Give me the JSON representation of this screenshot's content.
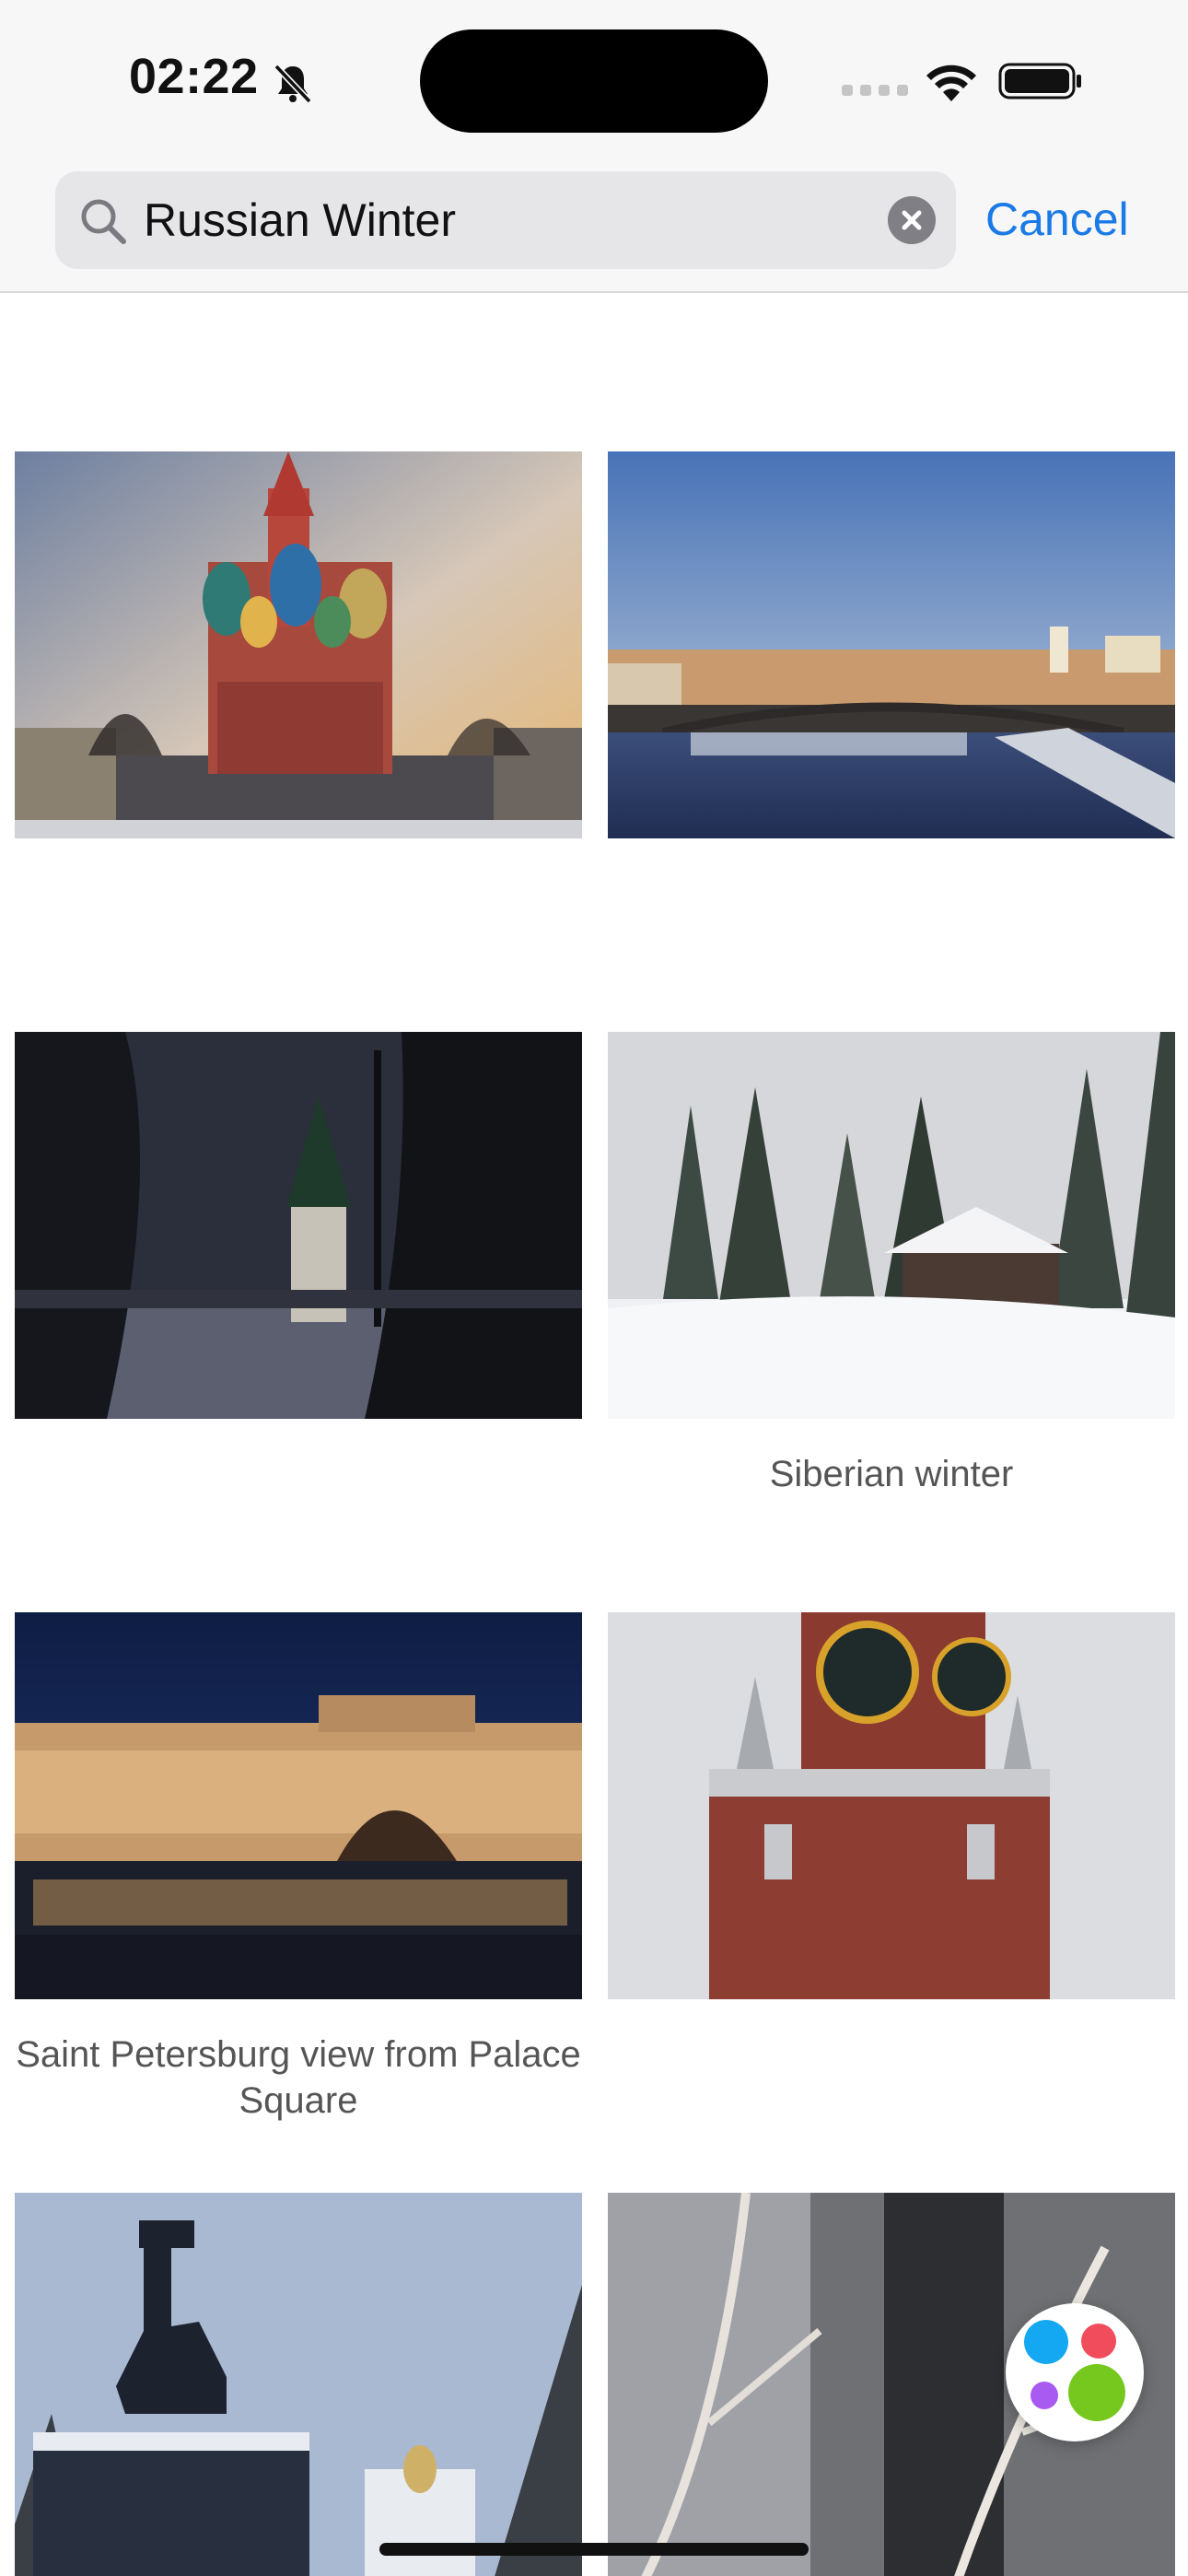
{
  "status": {
    "time": "02:22"
  },
  "search": {
    "query": "Russian Winter",
    "cancel_label": "Cancel"
  },
  "results": [
    {
      "caption": ""
    },
    {
      "caption": ""
    },
    {
      "caption": ""
    },
    {
      "caption": "Siberian winter"
    },
    {
      "caption": "Saint Petersburg view from Palace Square"
    },
    {
      "caption": ""
    },
    {
      "caption": ""
    },
    {
      "caption": ""
    }
  ],
  "colors": {
    "accent": "#1a7ae6"
  }
}
